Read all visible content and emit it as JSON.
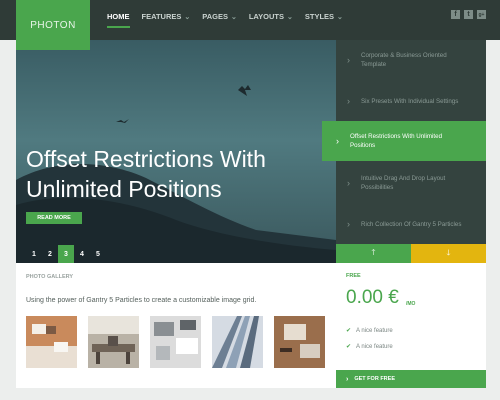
{
  "logo": "PHOTON",
  "nav": [
    {
      "label": "HOME",
      "active": true
    },
    {
      "label": "FEATURES"
    },
    {
      "label": "PAGES"
    },
    {
      "label": "LAYOUTS"
    },
    {
      "label": "STYLES"
    }
  ],
  "social": [
    "f",
    "t",
    "g+"
  ],
  "hero": {
    "title_line1": "Offset Restrictions With",
    "title_line2": "Unlimited Positions",
    "read_more": "READ MORE",
    "pages": [
      "1",
      "2",
      "3",
      "4",
      "5"
    ],
    "active_page": "3"
  },
  "features": [
    "Corporate & Business Oriented Template",
    "Six Presets With Individual Settings",
    "Offset Restrictions With Unlimited Positions",
    "Intuitive Drag And Drop Layout Possibilities",
    "Rich Collection Of Gantry 5 Particles"
  ],
  "active_feature_index": 2,
  "gallery": {
    "label": "PHOTO GALLERY",
    "description": "Using the power of Gantry 5 Particles to create a customizable image grid."
  },
  "pricing": {
    "label": "FREE",
    "price": "0.00 €",
    "period": "/MO",
    "items": [
      "A nice feature",
      "A nice feature"
    ],
    "cta": "GET FOR FREE"
  },
  "colors": {
    "accent": "#4aa64d",
    "secondary": "#e3b50f",
    "dark": "#2f3b37"
  }
}
